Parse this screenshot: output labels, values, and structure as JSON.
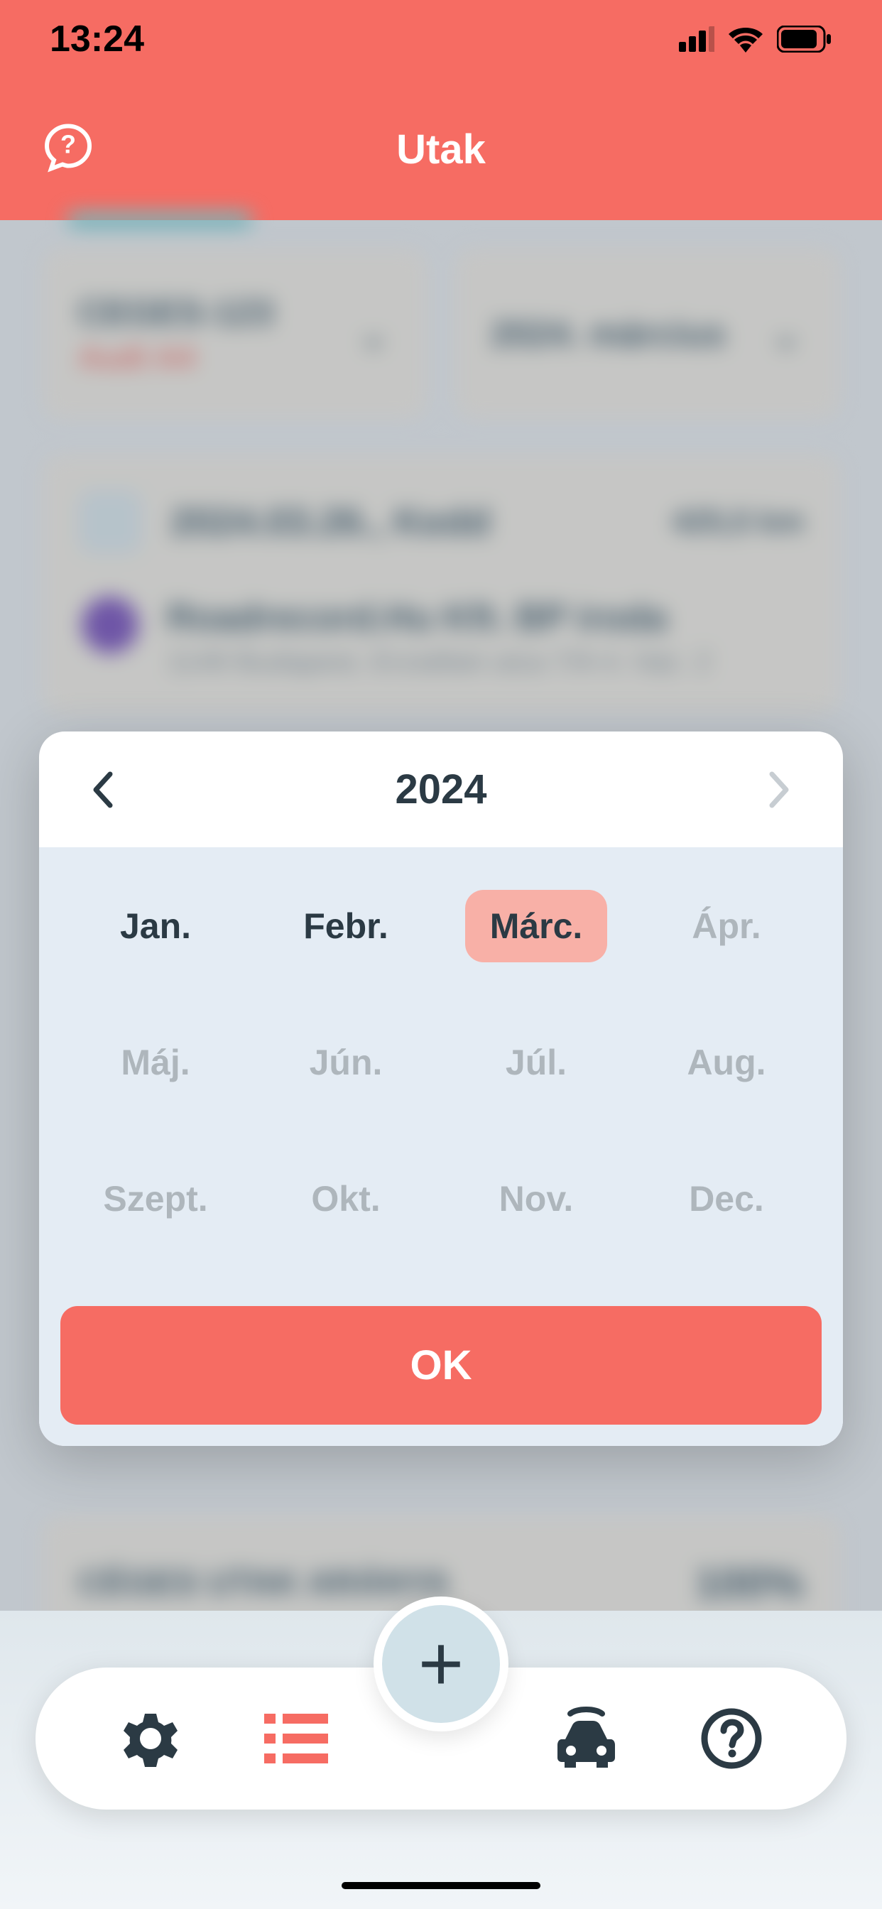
{
  "status": {
    "time": "13:24"
  },
  "header": {
    "title": "Utak"
  },
  "selectors": {
    "vehicle_code": "CEGES-123",
    "vehicle_name": "Audi A4",
    "period": "2024. március"
  },
  "trip": {
    "date": "2024.03.26., Kedd",
    "distance": "425,5 km",
    "place_name": "Roadrecord.Hu Kft. BP iroda",
    "place_addr": "1149 Budapest, Erzsébet utca 7/A 4. ház. 2"
  },
  "summary": {
    "label": "CÉGES UTAK ARÁNYA",
    "value": "100%"
  },
  "modal": {
    "year": "2024",
    "months": [
      {
        "label": "Jan.",
        "enabled": true,
        "selected": false
      },
      {
        "label": "Febr.",
        "enabled": true,
        "selected": false
      },
      {
        "label": "Márc.",
        "enabled": true,
        "selected": true
      },
      {
        "label": "Ápr.",
        "enabled": false,
        "selected": false
      },
      {
        "label": "Máj.",
        "enabled": false,
        "selected": false
      },
      {
        "label": "Jún.",
        "enabled": false,
        "selected": false
      },
      {
        "label": "Júl.",
        "enabled": false,
        "selected": false
      },
      {
        "label": "Aug.",
        "enabled": false,
        "selected": false
      },
      {
        "label": "Szept.",
        "enabled": false,
        "selected": false
      },
      {
        "label": "Okt.",
        "enabled": false,
        "selected": false
      },
      {
        "label": "Nov.",
        "enabled": false,
        "selected": false
      },
      {
        "label": "Dec.",
        "enabled": false,
        "selected": false
      }
    ],
    "ok_label": "OK"
  }
}
